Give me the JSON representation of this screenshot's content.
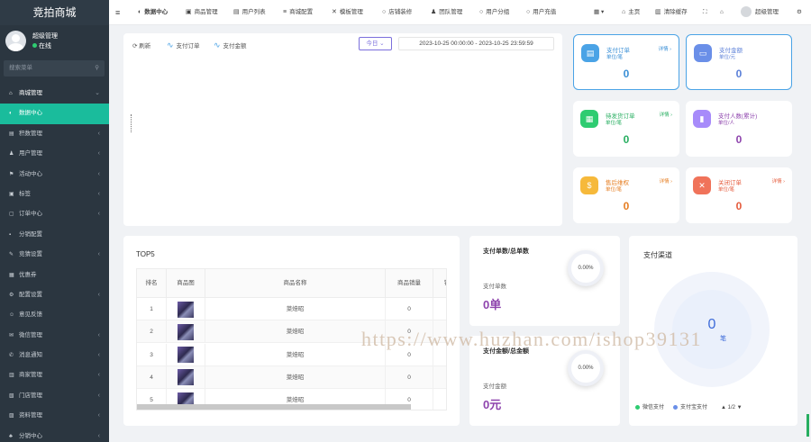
{
  "app": {
    "brand": "竞拍商城"
  },
  "user": {
    "name": "超级管理",
    "status": "在线"
  },
  "search": {
    "placeholder": "搜索菜单"
  },
  "menu": [
    {
      "icon": "home-icon",
      "glyph": "⌂",
      "label": "商城管理",
      "chevron": "⌄"
    },
    {
      "icon": "dashboard-icon",
      "glyph": "◐",
      "label": "数据中心",
      "chevron": ""
    },
    {
      "icon": "doc-icon",
      "glyph": "▤",
      "label": "积数管理",
      "chevron": "‹"
    },
    {
      "icon": "user-icon",
      "glyph": "♟",
      "label": "用户管理",
      "chevron": "‹"
    },
    {
      "icon": "flag-icon",
      "glyph": "⚑",
      "label": "活动中心",
      "chevron": "‹"
    },
    {
      "icon": "tag-icon",
      "glyph": "▣",
      "label": "标签",
      "chevron": "‹"
    },
    {
      "icon": "order-icon",
      "glyph": "▢",
      "label": "订单中心",
      "chevron": "‹"
    },
    {
      "icon": "config-icon",
      "glyph": "▪",
      "label": "分销配置",
      "chevron": ""
    },
    {
      "icon": "wrench-icon",
      "glyph": "✎",
      "label": "竞猜设置",
      "chevron": "‹"
    },
    {
      "icon": "coupon-icon",
      "glyph": "▦",
      "label": "优惠券",
      "chevron": ""
    },
    {
      "icon": "gear-icon",
      "glyph": "⚙",
      "label": "配置设置",
      "chevron": "‹"
    },
    {
      "icon": "feedback-icon",
      "glyph": "☺",
      "label": "意见反馈",
      "chevron": ""
    },
    {
      "icon": "wechat-icon",
      "glyph": "✉",
      "label": "微信管理",
      "chevron": "‹"
    },
    {
      "icon": "notice-icon",
      "glyph": "✆",
      "label": "消息通知",
      "chevron": "‹"
    },
    {
      "icon": "merchant-icon",
      "glyph": "▥",
      "label": "商家管理",
      "chevron": "‹"
    },
    {
      "icon": "store-icon",
      "glyph": "▧",
      "label": "门店管理",
      "chevron": "‹"
    },
    {
      "icon": "profile-icon",
      "glyph": "▨",
      "label": "资料管理",
      "chevron": "‹"
    },
    {
      "icon": "group-icon",
      "glyph": "♣",
      "label": "分销中心",
      "chevron": "‹"
    }
  ],
  "topbar": {
    "menu_glyph": "≡",
    "tabs": [
      {
        "glyph": "◐",
        "label": "数据中心"
      },
      {
        "glyph": "▣",
        "label": "商品管理"
      },
      {
        "glyph": "▤",
        "label": "用户列表"
      },
      {
        "glyph": "≡",
        "label": "商城配置"
      },
      {
        "glyph": "✕",
        "label": "模板管理"
      },
      {
        "glyph": "○",
        "label": "店铺装修"
      },
      {
        "glyph": "♟",
        "label": "团队管理"
      },
      {
        "glyph": "○",
        "label": "用户分组"
      },
      {
        "glyph": "○",
        "label": "用户充值"
      }
    ],
    "grid_glyph": "▦ ▾",
    "home_label": "主页",
    "clear_label": "清除缓存",
    "fullscreen_glyph": "⛶",
    "lock_glyph": "⌂",
    "user_label": "超级管理",
    "settings_glyph": "⚙"
  },
  "chart_panel": {
    "refresh_label": "刷新",
    "legend1": "支付订单",
    "legend2": "支付金额",
    "today_label": "今日 ⌄",
    "date_range": "2023-10-25 00:00:00  -  2023-10-25 23:59:59"
  },
  "stats": [
    {
      "icon": "order-doc-icon",
      "glyph": "▤",
      "bg": "#4aa3e6",
      "title": "支付订单",
      "unit": "单位/笔",
      "detail": "详情 ›",
      "value": "0",
      "color": "#3a8fd6"
    },
    {
      "icon": "wallet-icon",
      "glyph": "▭",
      "bg": "#6a8fe8",
      "title": "支付金额",
      "unit": "单位/元",
      "detail": "",
      "value": "0",
      "color": "#5a7fd8"
    },
    {
      "icon": "calendar-icon",
      "glyph": "▦",
      "bg": "#2ecc71",
      "title": "待发货订单",
      "unit": "单位/笔",
      "detail": "详情 ›",
      "value": "0",
      "color": "#27ae60"
    },
    {
      "icon": "bar-chart-icon",
      "glyph": "▮",
      "bg": "#a78bfa",
      "title": "支付人数(累计)",
      "unit": "单位/人",
      "detail": "",
      "value": "0",
      "color": "#8e44ad"
    },
    {
      "icon": "coin-icon",
      "glyph": "$",
      "bg": "#f6b93b",
      "title": "售后维权",
      "unit": "单位/笔",
      "detail": "详情 ›",
      "value": "0",
      "color": "#e67e22"
    },
    {
      "icon": "close-order-icon",
      "glyph": "✕",
      "bg": "#f0735a",
      "title": "关闭订单",
      "unit": "单位/笔",
      "detail": "详情 ›",
      "value": "0",
      "color": "#e55b3c"
    }
  ],
  "top5": {
    "title": "TOP5",
    "headers": [
      "排名",
      "商品图",
      "商品名称",
      "商品销量",
      "销"
    ],
    "rows": [
      {
        "rank": "1",
        "name": "菜焙昭",
        "sales": "0"
      },
      {
        "rank": "2",
        "name": "菜焙昭",
        "sales": "0"
      },
      {
        "rank": "3",
        "name": "菜焙昭",
        "sales": "0"
      },
      {
        "rank": "4",
        "name": "菜焙昭",
        "sales": "0"
      },
      {
        "rank": "5",
        "name": "菜焙昭",
        "sales": "0"
      }
    ]
  },
  "pay_count": {
    "title": "支付单数/总单数",
    "ratio": "0.00%",
    "label": "支付单数",
    "value": "0单"
  },
  "pay_amount": {
    "title": "支付金额/总金额",
    "ratio": "0.00%",
    "label": "支付金额",
    "value": "0元"
  },
  "channel": {
    "title": "支付渠道",
    "value": "0",
    "unit": "笔",
    "legend": [
      {
        "label": "微信支付",
        "color": "#2ecc71"
      },
      {
        "label": "支付宝支付",
        "color": "#6a8fe8"
      }
    ],
    "pager": "▲ 1/2 ▼"
  },
  "watermark": "https://www.huzhan.com/ishop39131"
}
